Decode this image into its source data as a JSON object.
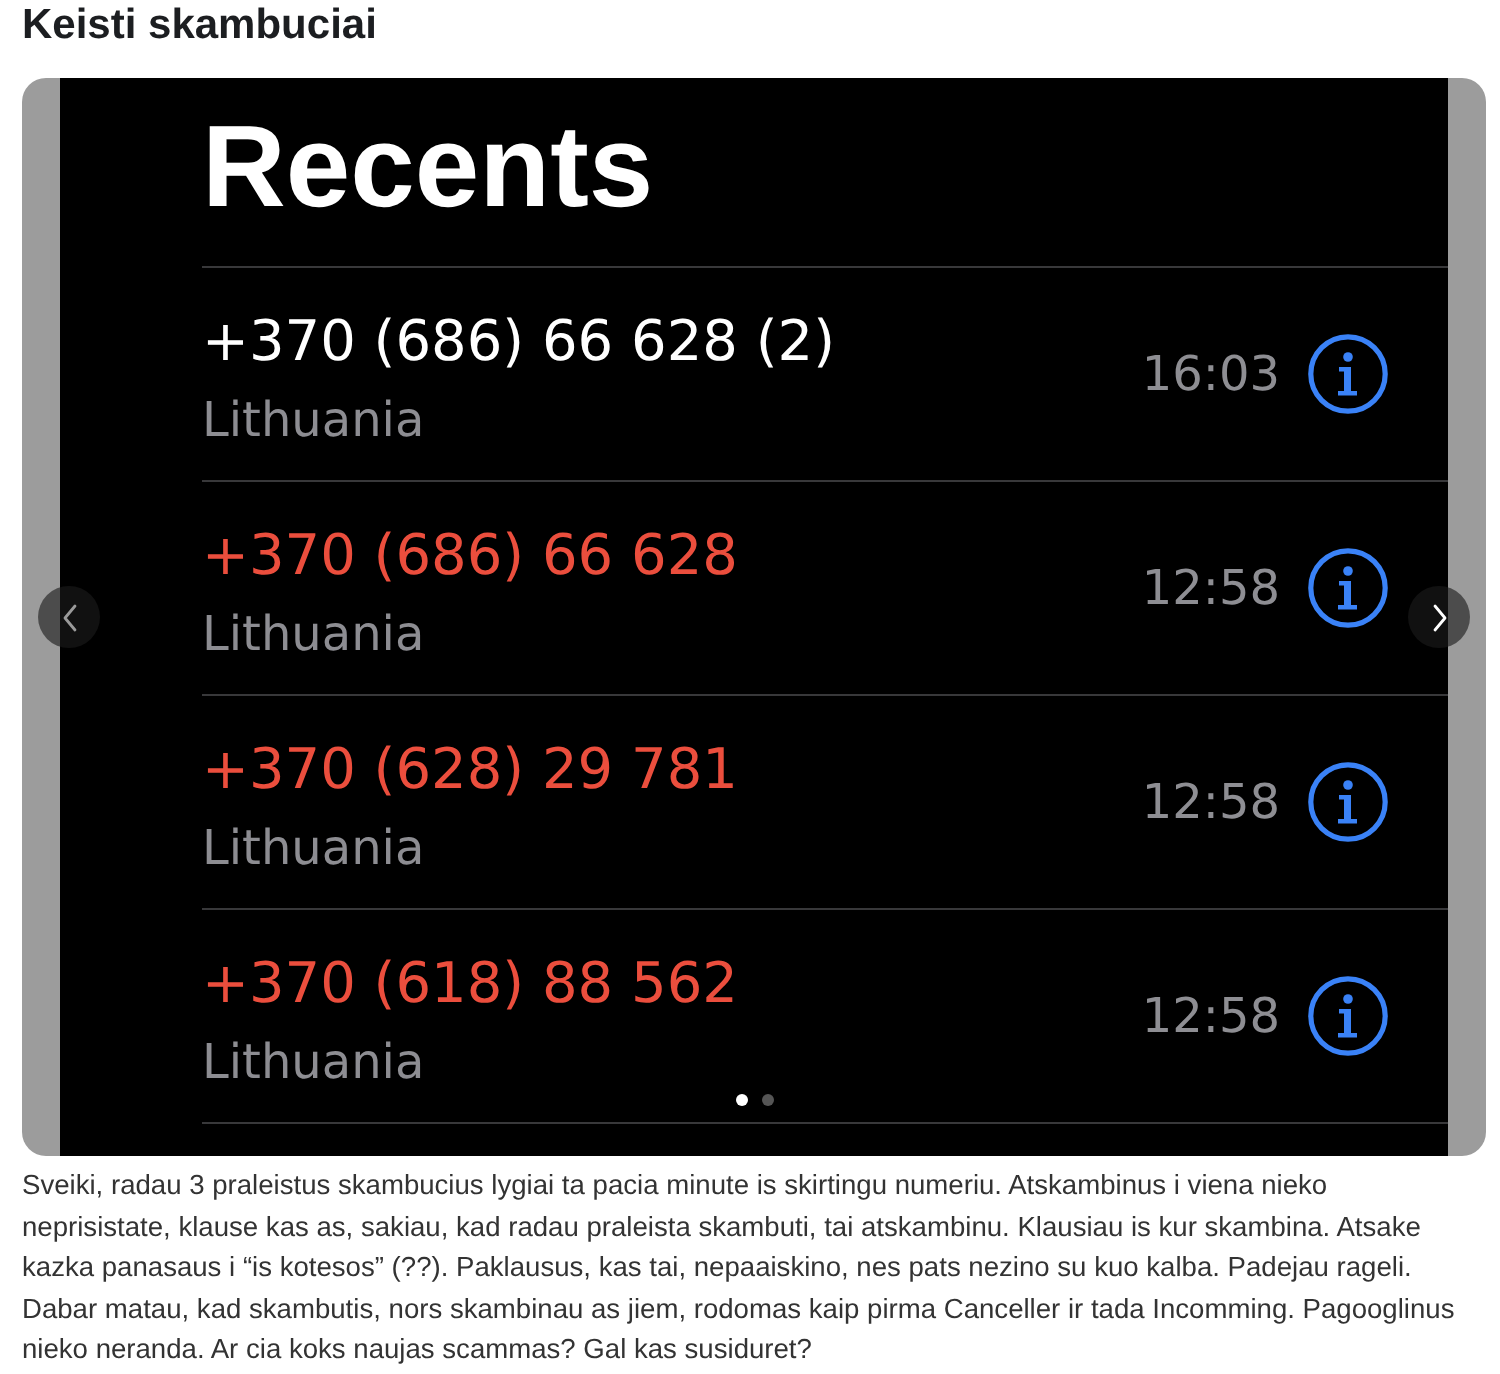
{
  "post": {
    "title": "Keisti skambuciai"
  },
  "carousel": {
    "previous_button": {
      "disabled": true
    },
    "next_button": {
      "disabled": false
    },
    "screenshot": {
      "title": "Recents",
      "calls": [
        {
          "number": "+370 (686) 66 628 (2)",
          "location": "Lithuania",
          "time": "16:03",
          "missed": false
        },
        {
          "number": "+370 (686) 66 628",
          "location": "Lithuania",
          "time": "12:58",
          "missed": true
        },
        {
          "number": "+370 (628) 29 781",
          "location": "Lithuania",
          "time": "12:58",
          "missed": true
        },
        {
          "number": "+370 (618) 88 562",
          "location": "Lithuania",
          "time": "12:58",
          "missed": true
        }
      ]
    },
    "pages": [
      {
        "selected": true
      },
      {
        "selected": false
      }
    ]
  },
  "body": "Sveiki, radau 3 praleistus skambucius lygiai ta pacia minute is skirtingu numeriu. Atskambinus i viena nieko neprisistate, klause kas as, sakiau, kad radau praleista skambuti, tai atskambinu. Klausiau is kur skambina. Atsake kazka panasaus i “is kotesos” (??). Paklausus, kas tai, nepaaiskino, nes pats nezino su kuo kalba. Padejau rageli. Dabar matau, kad skambutis, nors skambinau as jiem, rodomas kaip pirma Canceller ir tada Incomming. Pagooglinus nieko neranda. Ar cia koks naujas scammas? Gal kas susiduret?"
}
